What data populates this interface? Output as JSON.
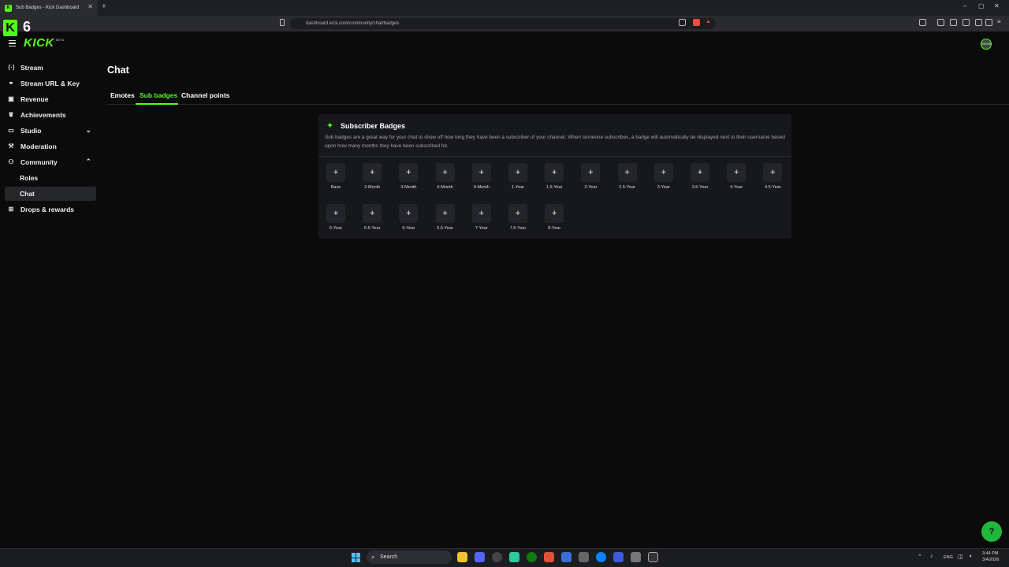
{
  "browser": {
    "tab_title": "Sub Badges - Kick Dashboard",
    "tab_close": "✕",
    "new_tab": "+",
    "url": "dashboard.kick.com/community/chat/badges",
    "window_controls": [
      "–",
      "▢",
      "✕"
    ]
  },
  "overlay": {
    "logo_letter": "K",
    "number": "6"
  },
  "app": {
    "logo_text": "KICK",
    "logo_badge": "BETA",
    "avatar_text": "SHOW"
  },
  "sidebar": {
    "items": [
      {
        "label": "Stream",
        "icon": "broadcast-icon",
        "glyph": "⟨·⟩"
      },
      {
        "label": "Stream URL & Key",
        "icon": "link-icon",
        "glyph": "⚭"
      },
      {
        "label": "Revenue",
        "icon": "revenue-icon",
        "glyph": "▣"
      },
      {
        "label": "Achievements",
        "icon": "trophy-icon",
        "glyph": "♛"
      },
      {
        "label": "Studio",
        "icon": "studio-icon",
        "glyph": "▭",
        "chevron": "⌄"
      },
      {
        "label": "Moderation",
        "icon": "hammer-icon",
        "glyph": "⚒"
      },
      {
        "label": "Community",
        "icon": "community-icon",
        "glyph": "⚇",
        "chevron": "⌃"
      },
      {
        "label": "Drops & rewards",
        "icon": "gift-icon",
        "glyph": "⊞"
      }
    ],
    "community_sub": [
      {
        "label": "Roles"
      },
      {
        "label": "Chat",
        "active": true
      }
    ]
  },
  "main": {
    "title": "Chat",
    "tabs": [
      {
        "label": "Emotes"
      },
      {
        "label": "Sub badges",
        "active": true
      },
      {
        "label": "Channel points"
      }
    ]
  },
  "panel": {
    "icon": "sparkle-icon",
    "title": "Subscriber Badges",
    "description": "Sub badges are a great way for your chat to show off how long they have been a subscriber of your channel. When someone subscribes, a badge will automatically be displayed next to their username based upon how many months they have been subscribed for.",
    "add_glyph": "+",
    "badges": [
      "Base",
      "2-Month",
      "3-Month",
      "6-Month",
      "9-Month",
      "1-Year",
      "1.5-Year",
      "2-Year",
      "2.5-Year",
      "3-Year",
      "3.5-Year",
      "4-Year",
      "4.5-Year",
      "5-Year",
      "5.5-Year",
      "6-Year",
      "6.5-Year",
      "7-Year",
      "7.5-Year",
      "8-Year"
    ]
  },
  "help_fab_glyph": "?",
  "taskbar": {
    "search_placeholder": "Search",
    "lang": "ENG",
    "time": "3:44 PM",
    "date": "3/4/2026"
  },
  "colors": {
    "accent": "#53fc18",
    "background": "#0b0b0c",
    "panel": "#17181b"
  }
}
